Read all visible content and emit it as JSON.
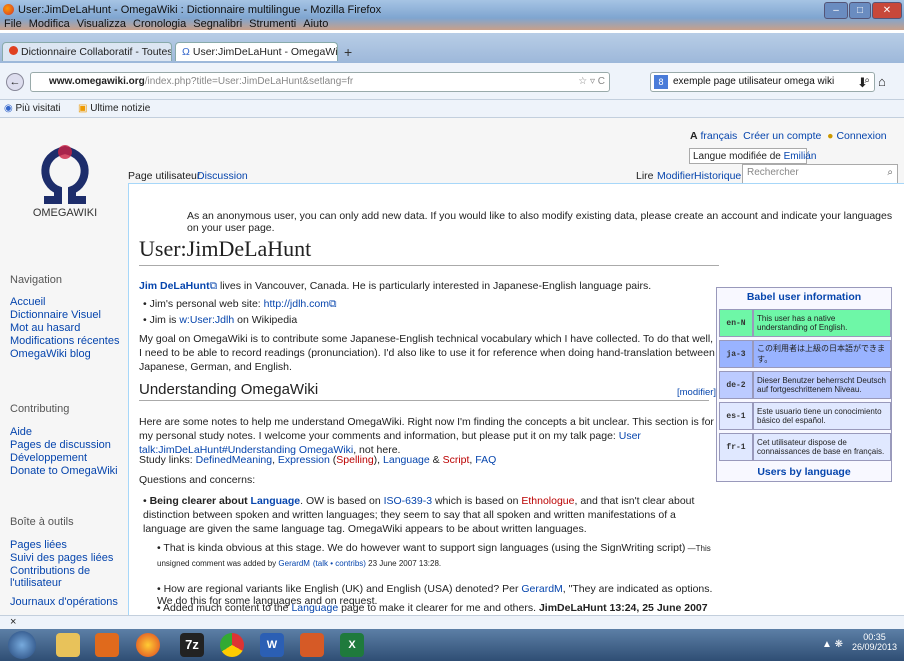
{
  "window": {
    "title": "User:JimDeLaHunt - OmegaWiki : Dictionnaire multilingue - Mozilla Firefox"
  },
  "menu": [
    "File",
    "Modifica",
    "Visualizza",
    "Cronologia",
    "Segnalibri",
    "Strumenti",
    "Aiuto"
  ],
  "tabs": [
    {
      "label": "Dictionnaire Collaboratif - Toutes les ..."
    },
    {
      "label": "User:JimDeLaHunt - OmegaWiki : Dic..."
    }
  ],
  "nav": {
    "url_host": "www.omegawiki.org",
    "url_path": "/index.php?title=User:JimDeLaHunt&setlang=fr",
    "search": "exemple page utilisateur omega wiki"
  },
  "bookmarks": [
    "Più visitati",
    "Ultime notizie"
  ],
  "logo_text": "OMEGAWIKI",
  "personal": {
    "lang": "français",
    "create": "Créer un compte",
    "login": "Connexion",
    "tooltip": "Langue modifiée de ",
    "tooltip_user": "Emilián"
  },
  "tabs_page": {
    "user": "Page utilisateur",
    "discussion": "Discussion",
    "read": "Lire",
    "edit": "Modifier",
    "history": "Historique",
    "search_placeholder": "Rechercher"
  },
  "sidebar": {
    "nav_head": "Navigation",
    "nav": [
      "Accueil",
      "Dictionnaire Visuel",
      "Mot au hasard",
      "Modifications récentes",
      "OmegaWiki blog"
    ],
    "contrib_head": "Contributing",
    "contrib": [
      "Aide",
      "Pages de discussion",
      "Développement",
      "Donate to OmegaWiki"
    ],
    "tools_head": "Boîte à outils",
    "tools": [
      "Pages liées",
      "Suivi des pages liées",
      "Contributions de l'utilisateur",
      "Journaux d'opérations"
    ]
  },
  "notice": "As an anonymous user, you can only add new data. If you would like to also modify existing data, please create an account and indicate your languages on your user page.",
  "page_title": "User:JimDeLaHunt",
  "intro": {
    "name": "Jim DeLaHunt",
    "rest": " lives in Vancouver, Canada. He is particularly interested in Japanese-English language pairs."
  },
  "bullets": {
    "b1": "Jim's personal web site: ",
    "b1link": "http://jdlh.com",
    "b2": "Jim is ",
    "b2link": "w:User:Jdlh",
    "b2rest": " on Wikipedia"
  },
  "goal": "My goal on OmegaWiki is to contribute some Japanese-English technical vocabulary which I have collected. To do that well, I need to be able to record readings (pronunciation). I'd also like to use it for reference when doing hand-translation between Japanese, German, and English.",
  "section": {
    "title": "Understanding OmegaWiki",
    "edit": "[modifier]"
  },
  "notes": "Here are some notes to help me understand OmegaWiki. Right now I'm finding the concepts a bit unclear. This section is for my personal study notes. I welcome your comments and information, but please put it on my talk page: ",
  "notes_link": "User talk:JimDeLaHunt#Understanding OmegaWiki",
  "notes_end": ", not here.",
  "study": {
    "label": "Study links: ",
    "l1": "DefinedMeaning",
    "l2": "Expression",
    "l3": "Spelling",
    "l4": "Language",
    "l5": "Script",
    "l6": "FAQ"
  },
  "questions": "Questions and concerns:",
  "q1": {
    "bold": "Being clearer about ",
    "boldlink": "Language",
    "a": ". OW is based on ",
    "l1": "ISO-639-3",
    "b": " which is based on ",
    "l2": "Ethnologue",
    "c": ", and that isn't clear about distinction between spoken and written languages; they seem to say that all spoken and written manifestations of a language are given the same language tag. OmegaWiki appears to be about written languages."
  },
  "s1": "That is kinda obvious at this stage. We do however want to support sign languages (using the SignWriting script)",
  "s1small": " —This unsigned comment was added by ",
  "s1user": "GerardM",
  "s1talk": "(talk • contribs)",
  "s1date": " 23 June 2007 13:28.",
  "s2": {
    "a": "How are regional variants like English (UK) and English (USA) denoted? Per ",
    "l": "GerardM",
    "b": ", \"They are indicated as options. We do this for some languages and on request."
  },
  "s3": {
    "a": "Added much content to the ",
    "l": "Language",
    "b": " page to make it clearer for me and others. ",
    "sig": "JimDeLaHunt 13:24, 25 June 2007 (EDT)"
  },
  "babel": {
    "title": "Babel user information",
    "footer": "Users by language",
    "rows": [
      {
        "code": "en-N",
        "text": "This user has a native understanding of English.",
        "color": "#6ef7a7"
      },
      {
        "code": "ja-3",
        "text": "この利用者は上級の日本語ができます。",
        "color": "#99b3ff"
      },
      {
        "code": "de-2",
        "text": "Dieser Benutzer beherrscht Deutsch auf fortgeschrittenem Niveau.",
        "color": "#bccbff"
      },
      {
        "code": "es-1",
        "text": "Este usuario tiene un conocimiento básico del español.",
        "color": "#e0e8ff"
      },
      {
        "code": "fr-1",
        "text": "Cet utilisateur dispose de connaissances de base en français.",
        "color": "#e0e8ff"
      }
    ]
  },
  "clock": {
    "time": "00:35",
    "date": "26/09/2013"
  }
}
